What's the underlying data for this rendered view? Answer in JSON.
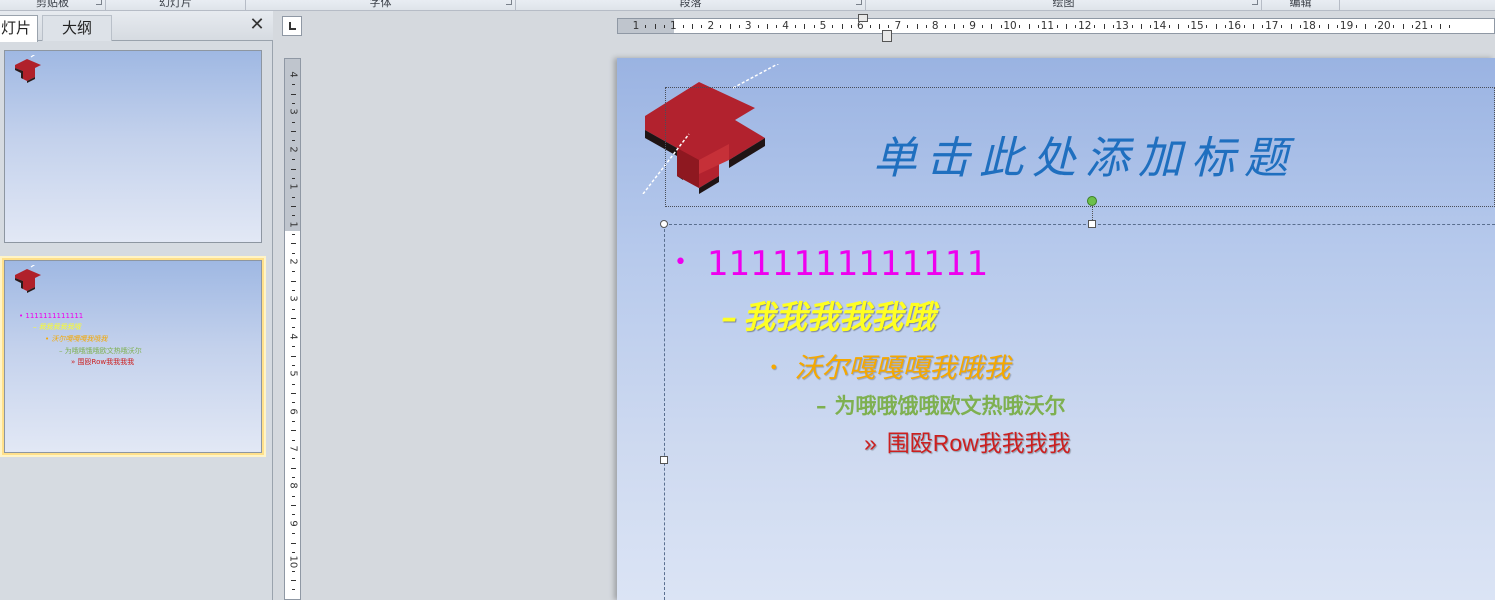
{
  "ribbon": {
    "groups": [
      {
        "label": "剪贴板"
      },
      {
        "label": "幻灯片"
      },
      {
        "label": "字体"
      },
      {
        "label": "段落"
      },
      {
        "label": "绘图"
      },
      {
        "label": "编辑"
      }
    ]
  },
  "left_pane": {
    "tabs": [
      {
        "label": "灯片"
      },
      {
        "label": "大纲"
      }
    ],
    "close_glyph": "✕",
    "thumbnails": [
      {
        "selected": false,
        "lines": []
      },
      {
        "selected": true,
        "lines": [
          "1111111111111",
          "我我我我我哦",
          "沃尔嘎嘎嘎我哦我",
          "为哦哦饿哦欧文热哦沃尔",
          "围殴Row我我我我"
        ]
      }
    ]
  },
  "rulers": {
    "horizontal_numbers": [
      "1",
      "1",
      "2",
      "3",
      "4",
      "5",
      "6",
      "7",
      "8",
      "9",
      "10",
      "11",
      "12",
      "13",
      "14",
      "15",
      "16",
      "17",
      "18",
      "19",
      "20",
      "21"
    ],
    "vertical_numbers": [
      "4",
      "3",
      "2",
      "1",
      "1",
      "2",
      "3",
      "4",
      "5",
      "6",
      "7",
      "8",
      "9",
      "10"
    ]
  },
  "slide": {
    "title_placeholder": "单击此处添加标题",
    "body": {
      "level1": {
        "bullet": "•",
        "text": "1111111111111"
      },
      "level2": {
        "bullet": "–",
        "text": "我我我我我哦"
      },
      "level3": {
        "bullet": "•",
        "text": "沃尔嘎嘎嘎我哦我"
      },
      "level4": {
        "bullet": "–",
        "text": "为哦哦饿哦欧文热哦沃尔"
      },
      "level5": {
        "bullet": "»",
        "text": "围殴Row我我我我"
      }
    },
    "colors": {
      "title": "#1f6fbf",
      "level1": "#ee00ee",
      "level2": "#ffff22",
      "level3": "#f5a800",
      "level4": "#7eb050",
      "level5": "#cc1f1f"
    },
    "logo_icon": "red-t-3d-logo"
  }
}
